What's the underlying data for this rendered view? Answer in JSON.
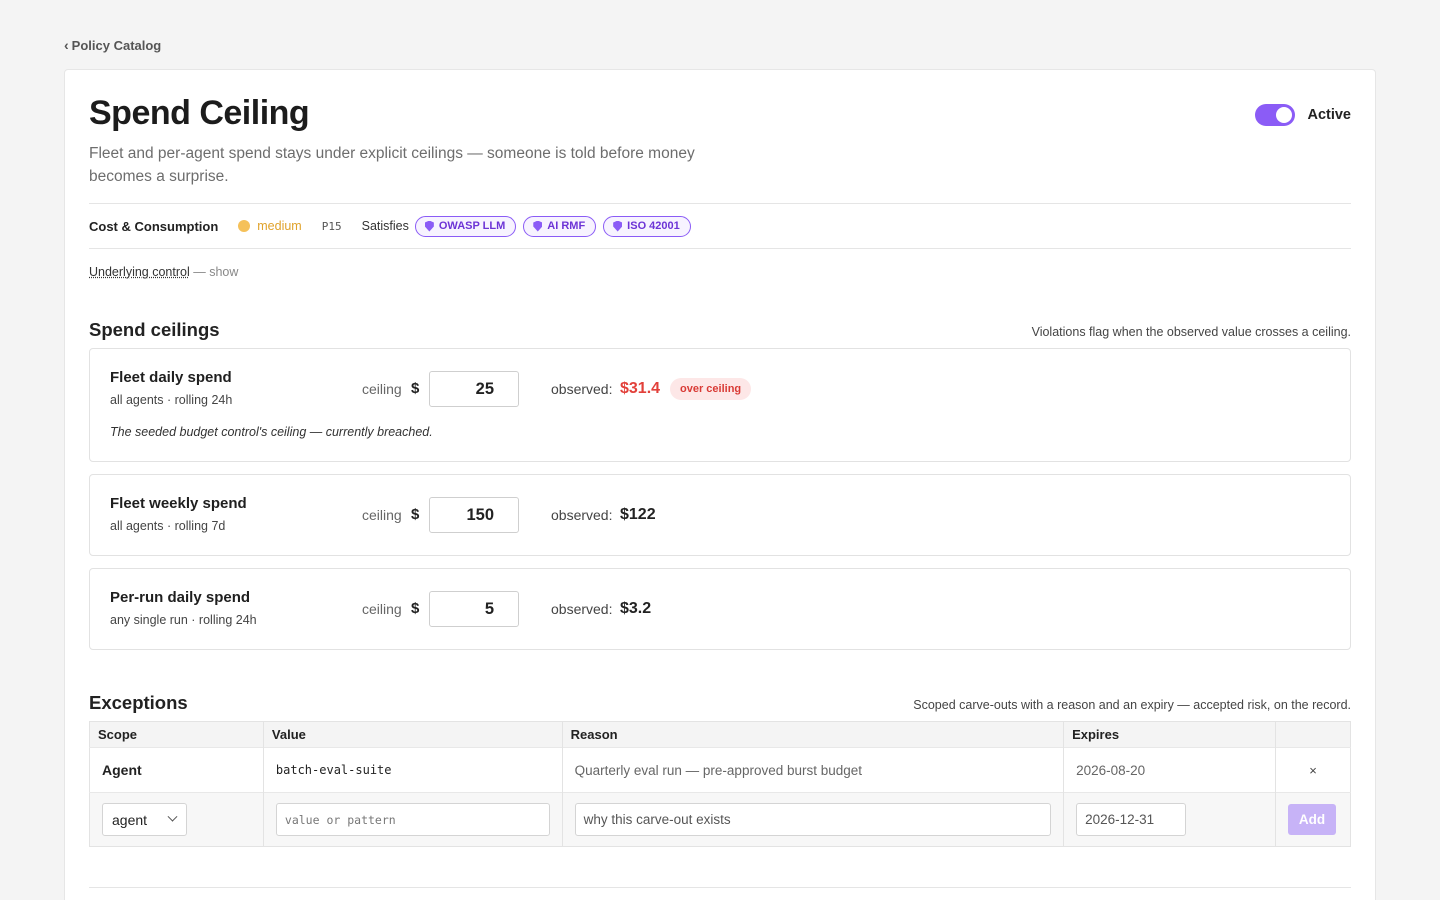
{
  "nav": {
    "back_label": "Policy Catalog",
    "back_chevron": "‹"
  },
  "policy": {
    "title": "Spend Ceiling",
    "description": "Fleet and per-agent spend stays under explicit ceilings — someone is told before money becomes a surprise.",
    "status_label": "Active",
    "active": true,
    "category": "Cost & Consumption",
    "severity": "medium",
    "code": "P15",
    "satisfies_label": "Satisfies",
    "frameworks": [
      "OWASP LLM",
      "AI RMF",
      "ISO 42001"
    ],
    "underlying_label": "Underlying control",
    "underlying_action": "— show"
  },
  "colors": {
    "accent": "#8b5cf6",
    "severity_medium": "#f5c15a",
    "over_red": "#e2403a"
  },
  "ceilings": {
    "title": "Spend ceilings",
    "note": "Violations flag when the observed value crosses a ceiling.",
    "ceiling_label": "ceiling",
    "currency": "$",
    "observed_label": "observed:",
    "items": [
      {
        "name": "Fleet daily spend",
        "scope": "all agents · rolling 24h",
        "ceiling": "25",
        "observed": "$31.4",
        "over": true,
        "badge": "over ceiling",
        "note": "The seeded budget control's ceiling — currently breached."
      },
      {
        "name": "Fleet weekly spend",
        "scope": "all agents · rolling 7d",
        "ceiling": "150",
        "observed": "$122",
        "over": false
      },
      {
        "name": "Per-run daily spend",
        "scope": "any single run · rolling 24h",
        "ceiling": "5",
        "observed": "$3.2",
        "over": false
      }
    ]
  },
  "exceptions": {
    "title": "Exceptions",
    "note": "Scoped carve-outs with a reason and an expiry — accepted risk, on the record.",
    "columns": [
      "Scope",
      "Value",
      "Reason",
      "Expires",
      ""
    ],
    "rows": [
      {
        "scope": "Agent",
        "value": "batch-eval-suite",
        "reason": "Quarterly eval run — pre-approved burst budget",
        "expires": "2026-08-20",
        "remove_icon": "×"
      }
    ],
    "new_row": {
      "scope_value": "agent",
      "value_placeholder": "value or pattern",
      "reason_placeholder": "why this carve-out exists",
      "expires_value": "2026-12-31",
      "add_label": "Add"
    }
  }
}
